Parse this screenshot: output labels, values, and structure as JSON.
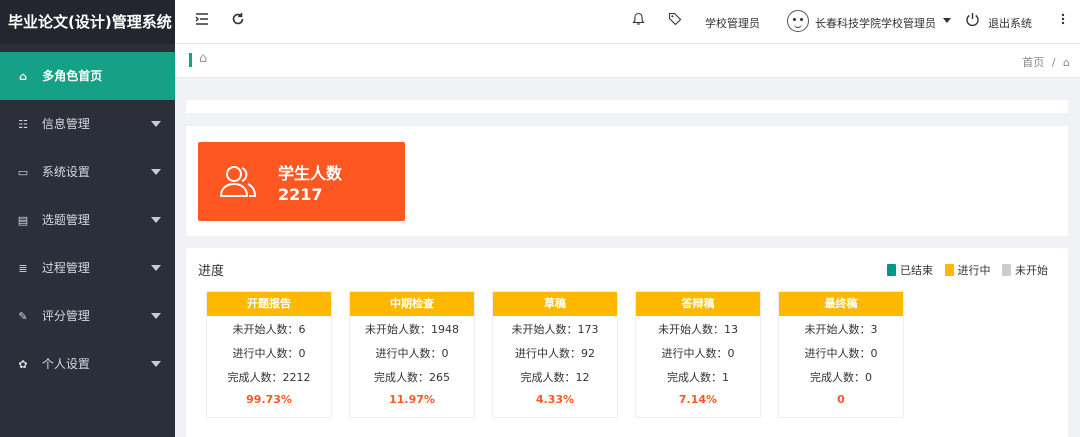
{
  "app": {
    "title": "毕业论文(设计)管理系统"
  },
  "sidebar": {
    "items": [
      {
        "label": "多角色首页",
        "icon": "home-icon",
        "glyph": "⌂",
        "active": true,
        "has_submenu": false
      },
      {
        "label": "信息管理",
        "icon": "list-icon",
        "glyph": "☷",
        "active": false,
        "has_submenu": true
      },
      {
        "label": "系统设置",
        "icon": "monitor-icon",
        "glyph": "▭",
        "active": false,
        "has_submenu": true
      },
      {
        "label": "选题管理",
        "icon": "document-icon",
        "glyph": "▤",
        "active": false,
        "has_submenu": true
      },
      {
        "label": "过程管理",
        "icon": "process-icon",
        "glyph": "≣",
        "active": false,
        "has_submenu": true
      },
      {
        "label": "评分管理",
        "icon": "edit-icon",
        "glyph": "✎",
        "active": false,
        "has_submenu": true
      },
      {
        "label": "个人设置",
        "icon": "user-settings-icon",
        "glyph": "✿",
        "active": false,
        "has_submenu": true
      }
    ]
  },
  "header": {
    "role": "学校管理员",
    "user_name": "长春科技学院学校管理员",
    "logout_label": "退出系统"
  },
  "breadcrumb": {
    "current": "首页",
    "separator": "/"
  },
  "stat": {
    "label": "学生人数",
    "value": "2217"
  },
  "progress": {
    "title": "进度",
    "legend": [
      {
        "label": "已结束",
        "color": "#009688"
      },
      {
        "label": "进行中",
        "color": "#ffb800"
      },
      {
        "label": "未开始",
        "color": "#cccccc"
      }
    ],
    "stages": [
      {
        "name": "开题报告",
        "not_started": "未开始人数：6",
        "in_progress": "进行中人数：0",
        "completed": "完成人数：2212",
        "percent": "99.73%"
      },
      {
        "name": "中期检查",
        "not_started": "未开始人数：1948",
        "in_progress": "进行中人数：0",
        "completed": "完成人数：265",
        "percent": "11.97%"
      },
      {
        "name": "草稿",
        "not_started": "未开始人数：173",
        "in_progress": "进行中人数：92",
        "completed": "完成人数：12",
        "percent": "4.33%"
      },
      {
        "name": "答辩稿",
        "not_started": "未开始人数：13",
        "in_progress": "进行中人数：0",
        "completed": "完成人数：1",
        "percent": "7.14%"
      },
      {
        "name": "最终稿",
        "not_started": "未开始人数：3",
        "in_progress": "进行中人数：0",
        "completed": "完成人数：0",
        "percent": "0"
      }
    ]
  },
  "colors": {
    "accent": "#16a085",
    "sidebar_bg": "#2b2f3a",
    "stat_card": "#ff5722",
    "stage_header": "#ffb800"
  }
}
